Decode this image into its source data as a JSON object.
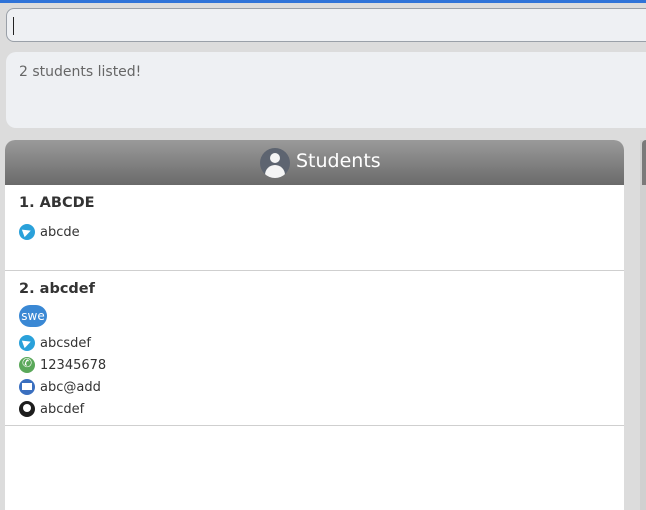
{
  "command": {
    "value": ""
  },
  "result": {
    "message": "2 students listed!"
  },
  "panel": {
    "title": "Students",
    "students": [
      {
        "index": "1.",
        "name": "ABCDE",
        "telegram": "abcde"
      },
      {
        "index": "2.",
        "name": "abcdef",
        "tag": "swe",
        "telegram": "abcsdef",
        "phone": "12345678",
        "email": "abc@add",
        "github": "abcdef"
      }
    ]
  },
  "colors": {
    "accent": "#2f73d8",
    "header_top": "#9a9a9a",
    "header_bottom": "#6a6a6a",
    "tag": "#3a88d4"
  }
}
